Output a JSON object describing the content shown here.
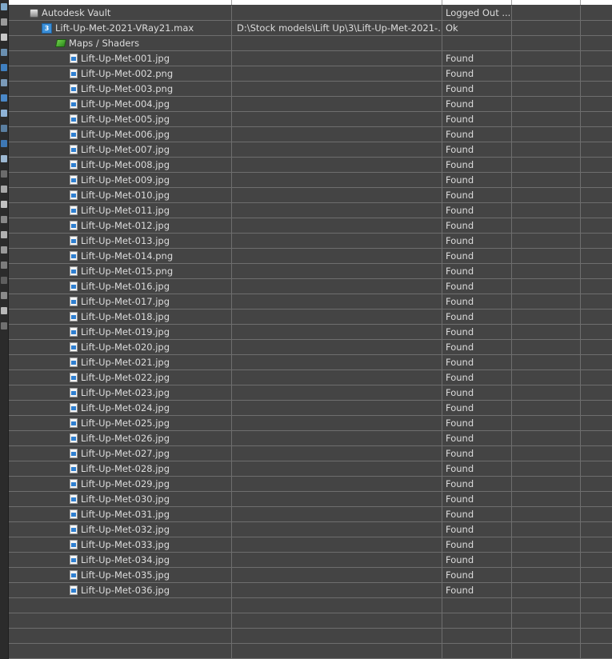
{
  "tree": {
    "vault_row": {
      "name": "Autodesk Vault",
      "path": "",
      "status": "Logged Out ...",
      "icon": "vault-icon"
    },
    "scene_row": {
      "name": "Lift-Up-Met-2021-VRay21.max",
      "path": "D:\\Stock models\\Lift Up\\3\\Lift-Up-Met-2021-...",
      "status": "Ok",
      "icon": "max-scene-icon"
    },
    "maps_row": {
      "name": "Maps / Shaders",
      "path": "",
      "status": "",
      "icon": "maps-shaders-icon"
    },
    "files": [
      {
        "name": "Lift-Up-Met-001.jpg",
        "status": "Found"
      },
      {
        "name": "Lift-Up-Met-002.png",
        "status": "Found"
      },
      {
        "name": "Lift-Up-Met-003.png",
        "status": "Found"
      },
      {
        "name": "Lift-Up-Met-004.jpg",
        "status": "Found"
      },
      {
        "name": "Lift-Up-Met-005.jpg",
        "status": "Found"
      },
      {
        "name": "Lift-Up-Met-006.jpg",
        "status": "Found"
      },
      {
        "name": "Lift-Up-Met-007.jpg",
        "status": "Found"
      },
      {
        "name": "Lift-Up-Met-008.jpg",
        "status": "Found"
      },
      {
        "name": "Lift-Up-Met-009.jpg",
        "status": "Found"
      },
      {
        "name": "Lift-Up-Met-010.jpg",
        "status": "Found"
      },
      {
        "name": "Lift-Up-Met-011.jpg",
        "status": "Found"
      },
      {
        "name": "Lift-Up-Met-012.jpg",
        "status": "Found"
      },
      {
        "name": "Lift-Up-Met-013.jpg",
        "status": "Found"
      },
      {
        "name": "Lift-Up-Met-014.png",
        "status": "Found"
      },
      {
        "name": "Lift-Up-Met-015.png",
        "status": "Found"
      },
      {
        "name": "Lift-Up-Met-016.jpg",
        "status": "Found"
      },
      {
        "name": "Lift-Up-Met-017.jpg",
        "status": "Found"
      },
      {
        "name": "Lift-Up-Met-018.jpg",
        "status": "Found"
      },
      {
        "name": "Lift-Up-Met-019.jpg",
        "status": "Found"
      },
      {
        "name": "Lift-Up-Met-020.jpg",
        "status": "Found"
      },
      {
        "name": "Lift-Up-Met-021.jpg",
        "status": "Found"
      },
      {
        "name": "Lift-Up-Met-022.jpg",
        "status": "Found"
      },
      {
        "name": "Lift-Up-Met-023.jpg",
        "status": "Found"
      },
      {
        "name": "Lift-Up-Met-024.jpg",
        "status": "Found"
      },
      {
        "name": "Lift-Up-Met-025.jpg",
        "status": "Found"
      },
      {
        "name": "Lift-Up-Met-026.jpg",
        "status": "Found"
      },
      {
        "name": "Lift-Up-Met-027.jpg",
        "status": "Found"
      },
      {
        "name": "Lift-Up-Met-028.jpg",
        "status": "Found"
      },
      {
        "name": "Lift-Up-Met-029.jpg",
        "status": "Found"
      },
      {
        "name": "Lift-Up-Met-030.jpg",
        "status": "Found"
      },
      {
        "name": "Lift-Up-Met-031.jpg",
        "status": "Found"
      },
      {
        "name": "Lift-Up-Met-032.jpg",
        "status": "Found"
      },
      {
        "name": "Lift-Up-Met-033.jpg",
        "status": "Found"
      },
      {
        "name": "Lift-Up-Met-034.jpg",
        "status": "Found"
      },
      {
        "name": "Lift-Up-Met-035.jpg",
        "status": "Found"
      },
      {
        "name": "Lift-Up-Met-036.jpg",
        "status": "Found"
      }
    ],
    "file_icon": "image-file-icon"
  },
  "colors": {
    "background": "#444444",
    "grid_line": "#6e6e6e",
    "text": "#dcdcdc",
    "header": "#ffffff"
  }
}
